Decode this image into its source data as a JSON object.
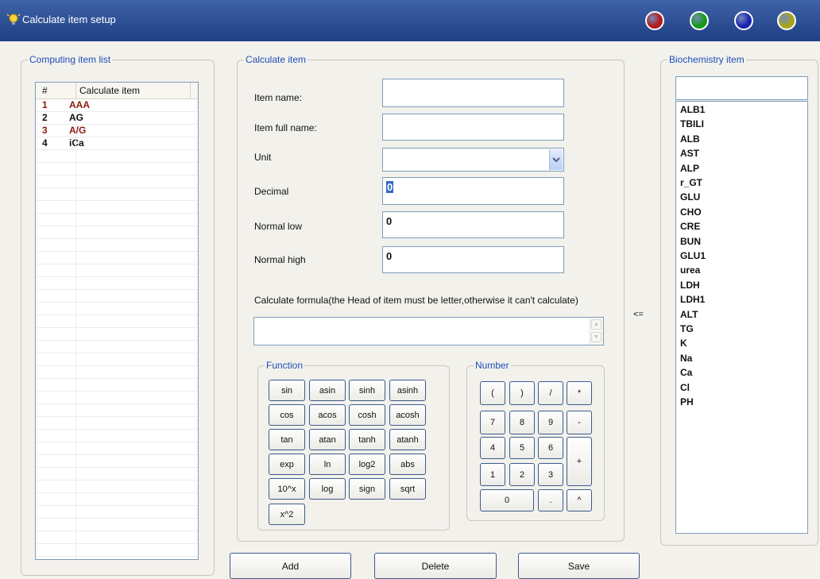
{
  "window": {
    "title": "Calculate item setup",
    "balls": [
      "#b11a1a",
      "#159a15",
      "#1b23b0",
      "#a8a51b"
    ]
  },
  "computing": {
    "legend": "Computing item list",
    "headers": [
      "#",
      "Calculate item"
    ],
    "rows": [
      {
        "num": "1",
        "name": "AAA",
        "color": "#8b1a0e"
      },
      {
        "num": "2",
        "name": "AG",
        "color": "#111111"
      },
      {
        "num": "3",
        "name": "A/G",
        "color": "#8b1a0e"
      },
      {
        "num": "4",
        "name": "iCa",
        "color": "#111111"
      }
    ]
  },
  "calc": {
    "legend": "Calculate item",
    "item_name_label": "Item name:",
    "item_full_name_label": "Item full name:",
    "unit_label": "Unit",
    "decimal_label": "Decimal",
    "decimal_value": "0",
    "normal_low_label": "Normal low",
    "normal_low_value": "0",
    "normal_high_label": "Normal high",
    "normal_high_value": "0",
    "formula_label": "Calculate formula(the Head of item  must be  letter,otherwise it can't calculate)",
    "arrow_label": "<="
  },
  "function": {
    "legend": "Function",
    "rows": [
      [
        "sin",
        "asin",
        "sinh",
        "asinh"
      ],
      [
        "cos",
        "acos",
        "cosh",
        "acosh"
      ],
      [
        "tan",
        "atan",
        "tanh",
        "atanh"
      ],
      [
        "exp",
        "ln",
        "log2",
        "abs"
      ],
      [
        "10^x",
        "log",
        "sign",
        "sqrt"
      ],
      [
        "x^2"
      ]
    ]
  },
  "number": {
    "legend": "Number",
    "row1": [
      "(",
      ")",
      "/",
      "*"
    ],
    "row2": [
      "7",
      "8",
      "9",
      "-"
    ],
    "row3": [
      "4",
      "5",
      "6"
    ],
    "row4": [
      "1",
      "2",
      "3"
    ],
    "plus": "+",
    "zero": "0",
    "dot": ".",
    "caret": "^"
  },
  "bio": {
    "legend": "Biochemistry item",
    "items": [
      "ALB1",
      "TBILI",
      "ALB",
      "AST",
      "ALP",
      "r_GT",
      "GLU",
      "CHO",
      "CRE",
      "BUN",
      "GLU1",
      "urea",
      "LDH",
      "LDH1",
      "ALT",
      "TG",
      "K",
      "Na",
      "Ca",
      "Cl",
      "PH"
    ]
  },
  "actions": {
    "add": "Add",
    "delete": "Delete",
    "save": "Save"
  }
}
